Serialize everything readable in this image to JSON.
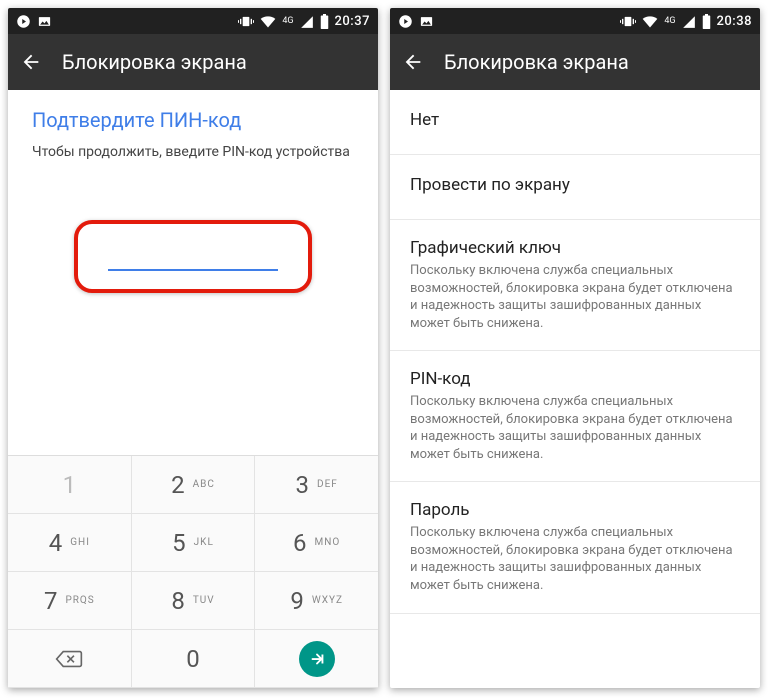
{
  "statusbar": {
    "time_left": "20:37",
    "time_right": "20:38",
    "net_label": "4G"
  },
  "appbar": {
    "title": "Блокировка экрана"
  },
  "pin": {
    "title": "Подтвердите ПИН-код",
    "subtitle": "Чтобы продолжить, введите PIN-код устройства",
    "value": ""
  },
  "keypad": {
    "keys": [
      {
        "d": "1",
        "l": ""
      },
      {
        "d": "2",
        "l": "ABC"
      },
      {
        "d": "3",
        "l": "DEF"
      },
      {
        "d": "4",
        "l": "GHI"
      },
      {
        "d": "5",
        "l": "JKL"
      },
      {
        "d": "6",
        "l": "MNO"
      },
      {
        "d": "7",
        "l": "PRQS"
      },
      {
        "d": "8",
        "l": "TUV"
      },
      {
        "d": "9",
        "l": "WXYZ"
      },
      {
        "d": "0",
        "l": ""
      }
    ]
  },
  "options": [
    {
      "title": "Нет",
      "desc": ""
    },
    {
      "title": "Провести по экрану",
      "desc": ""
    },
    {
      "title": "Графический ключ",
      "desc": "Поскольку включена служба специальных возможностей, блокировка экрана будет отключена и надежность защиты зашифрованных данных может быть снижена."
    },
    {
      "title": "PIN-код",
      "desc": "Поскольку включена служба специальных возможностей, блокировка экрана будет отключена и надежность защиты зашифрованных данных может быть снижена."
    },
    {
      "title": "Пароль",
      "desc": "Поскольку включена служба специальных возможностей, блокировка экрана будет отключена и надежность защиты зашифрованных данных может быть снижена."
    }
  ]
}
